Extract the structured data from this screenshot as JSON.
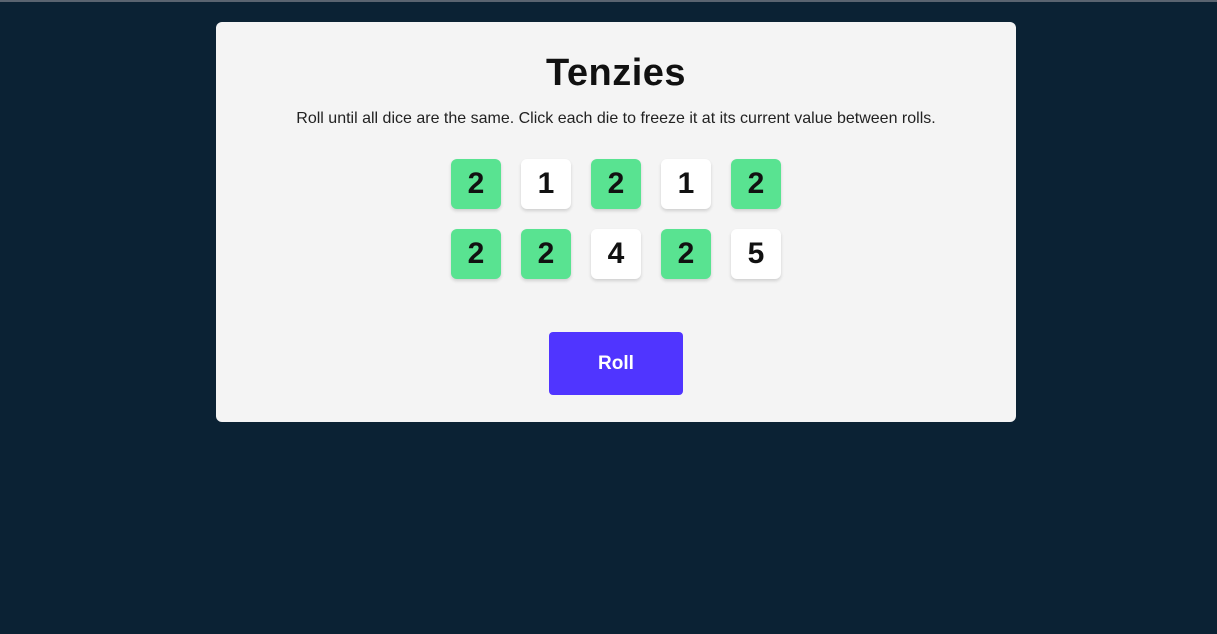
{
  "game": {
    "title": "Tenzies",
    "instructions": "Roll until all dice are the same. Click each die to freeze it at its current value between rolls.",
    "roll_label": "Roll"
  },
  "dice": [
    {
      "value": "2",
      "held": true
    },
    {
      "value": "1",
      "held": false
    },
    {
      "value": "2",
      "held": true
    },
    {
      "value": "1",
      "held": false
    },
    {
      "value": "2",
      "held": true
    },
    {
      "value": "2",
      "held": true
    },
    {
      "value": "2",
      "held": true
    },
    {
      "value": "4",
      "held": false
    },
    {
      "value": "2",
      "held": true
    },
    {
      "value": "5",
      "held": false
    }
  ],
  "colors": {
    "background": "#0b2234",
    "card": "#f4f4f4",
    "held_die": "#59e391",
    "die": "#ffffff",
    "roll_button": "#5035ff"
  }
}
